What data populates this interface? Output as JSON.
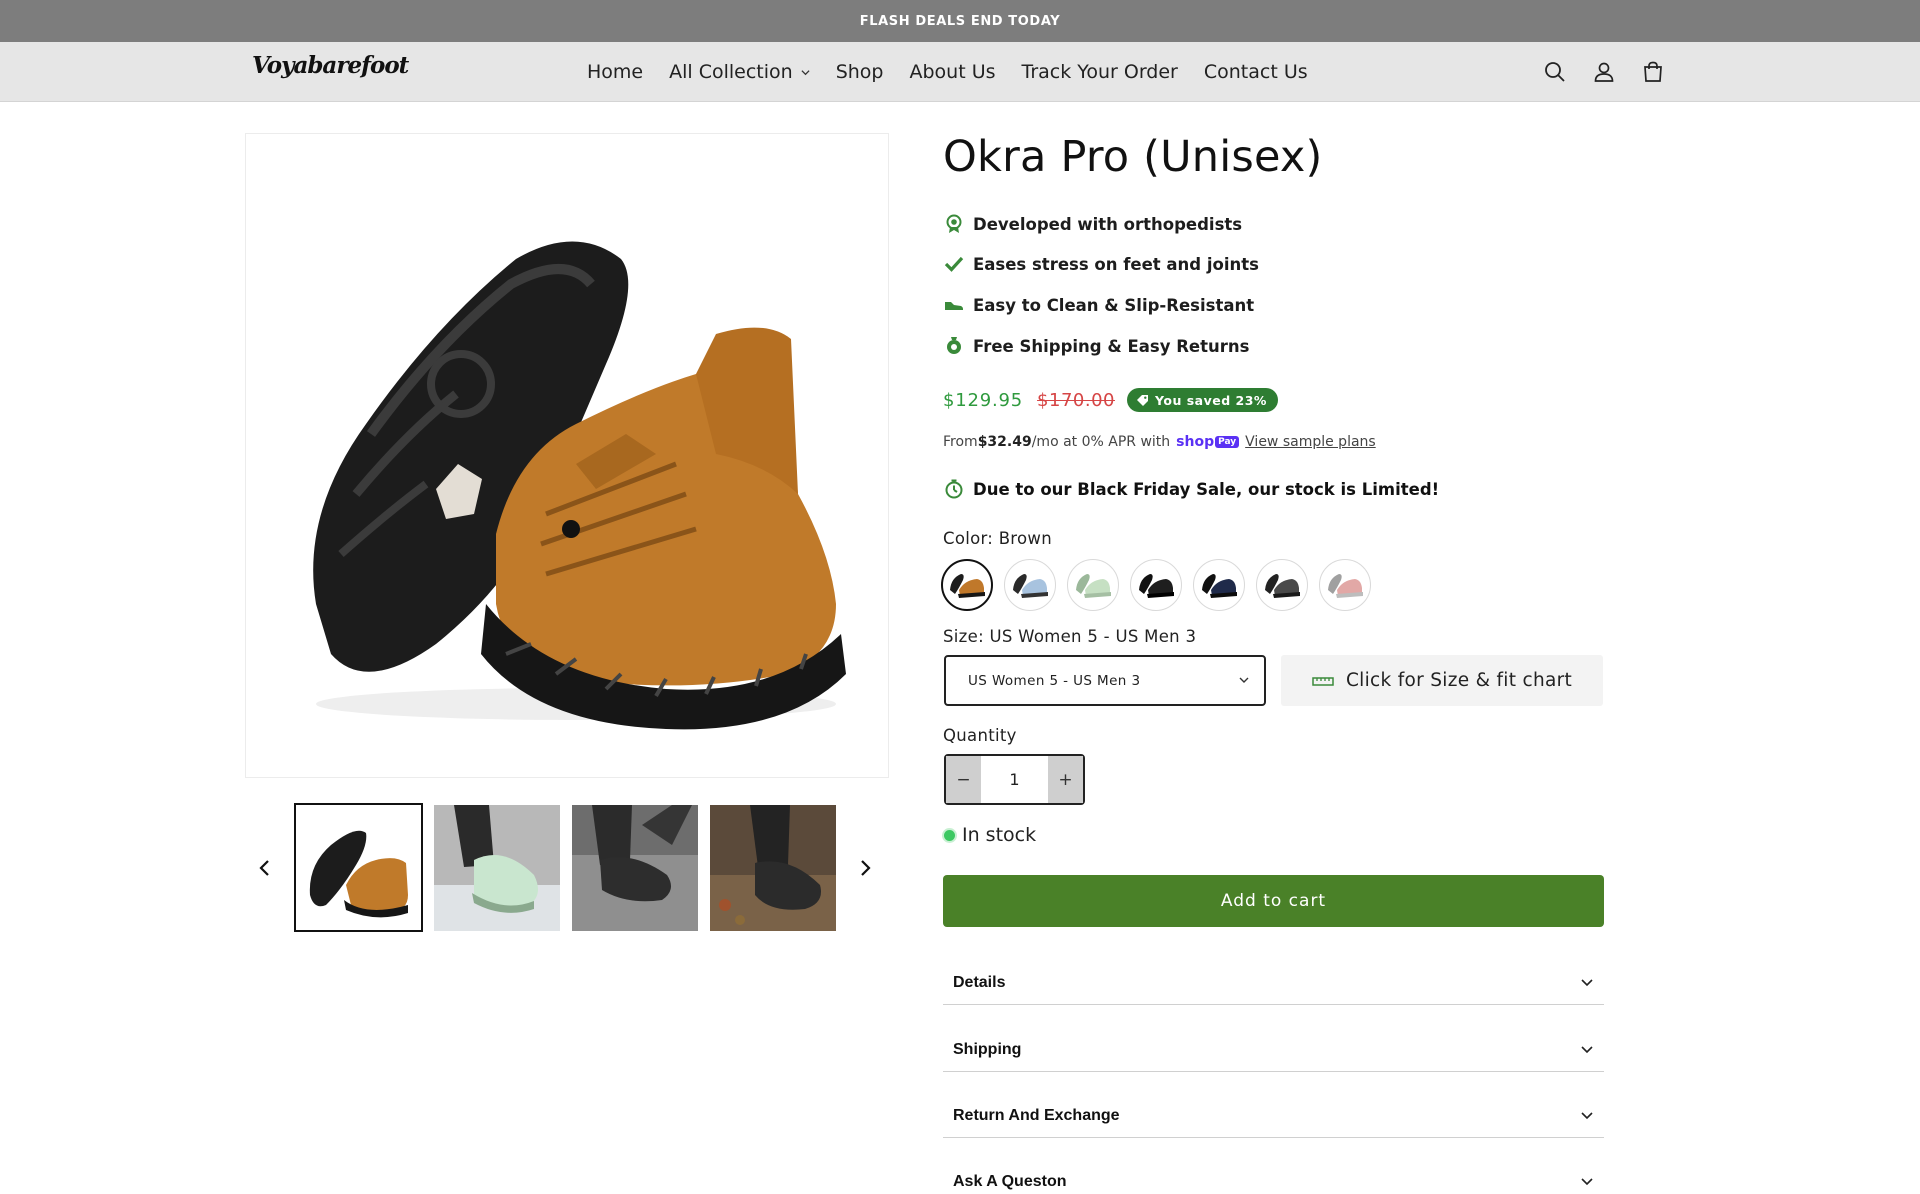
{
  "announcement": "FLASH DEALS END TODAY",
  "header": {
    "logo": "Voyabarefoot",
    "nav": [
      "Home",
      "All Collection",
      "Shop",
      "About Us",
      "Track Your Order",
      "Contact Us"
    ],
    "icons": [
      "search-icon",
      "account-icon",
      "cart-icon"
    ]
  },
  "product": {
    "title": "Okra Pro (Unisex)",
    "features": [
      {
        "icon": "award-icon",
        "text": "Developed with orthopedists"
      },
      {
        "icon": "checkmark-icon",
        "text": "Eases stress on feet and joints"
      },
      {
        "icon": "shoe-icon",
        "text": "Easy to Clean & Slip-Resistant"
      },
      {
        "icon": "shipping-icon",
        "text": "Free Shipping & Easy Returns"
      }
    ],
    "price": "$129.95",
    "compare_price": "$170.00",
    "saved_badge": "You saved 23%",
    "installment": {
      "prefix": "From ",
      "amount": "$32.49",
      "suffix": "/mo at 0% APR with",
      "shop": "shop",
      "pay": "Pay",
      "link": "View sample plans"
    },
    "stock_note": "Due to our Black Friday Sale, our stock is Limited!",
    "color_label": "Color: Brown",
    "colors": [
      {
        "name": "Brown",
        "upper": "#c0782a",
        "selected": true
      },
      {
        "name": "Blue",
        "upper": "#a8c3df"
      },
      {
        "name": "Mint",
        "upper": "#b7d6b4"
      },
      {
        "name": "Black",
        "upper": "#1e1e1e"
      },
      {
        "name": "Navy",
        "upper": "#1f2a4a"
      },
      {
        "name": "Grey",
        "upper": "#4a4a4a"
      },
      {
        "name": "Pink",
        "upper": "#e2a8a6"
      }
    ],
    "size_label": "Size: US Women 5 - US Men 3",
    "size_value": "US Women 5 - US Men 3",
    "size_chart_button": "Click for Size & fit chart",
    "quantity_label": "Quantity",
    "quantity": "1",
    "qty_minus": "−",
    "qty_plus": "+",
    "availability": "In stock",
    "add_to_cart": "Add to cart",
    "accordions": [
      "Details",
      "Shipping",
      "Return And Exchange",
      "Ask A Queston"
    ]
  },
  "colors": {
    "announcement_bg": "#7d7d7d",
    "header_bg": "#e6e6e6",
    "price": "#2f9a3e",
    "compare_price": "#d64545",
    "badge": "#2e7d32",
    "add_to_cart": "#4a8128"
  }
}
